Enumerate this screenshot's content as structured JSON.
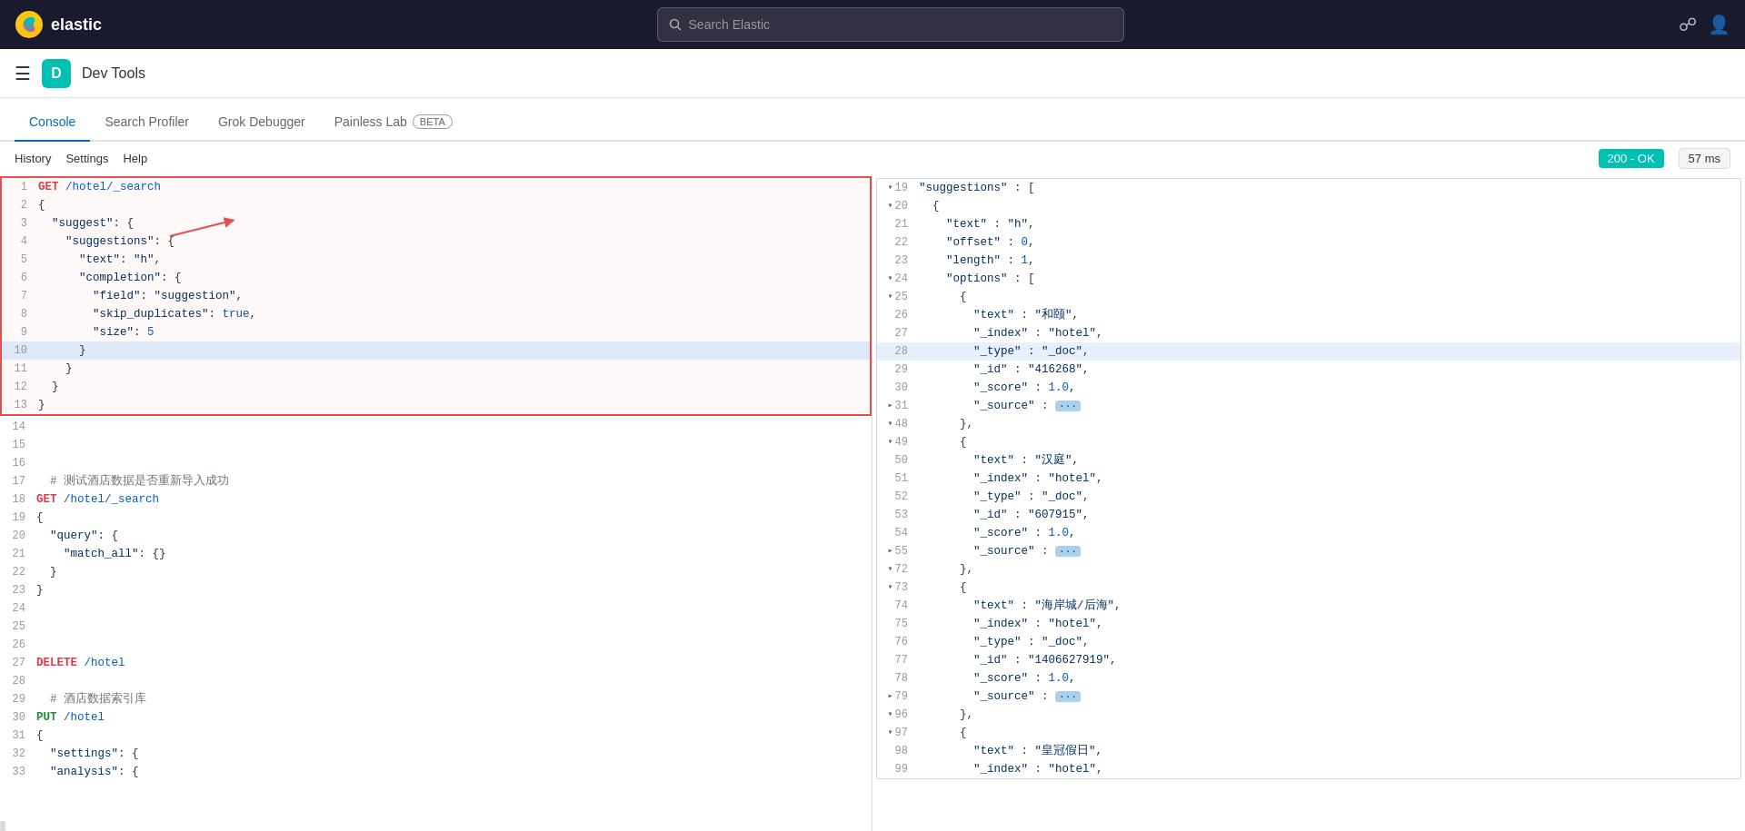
{
  "topbar": {
    "logo_text": "elastic",
    "search_placeholder": "Search Elastic",
    "app_title": "Dev Tools",
    "app_badge": "D"
  },
  "tabs": [
    {
      "id": "console",
      "label": "Console",
      "active": true,
      "beta": false
    },
    {
      "id": "search-profiler",
      "label": "Search Profiler",
      "active": false,
      "beta": false
    },
    {
      "id": "grok-debugger",
      "label": "Grok Debugger",
      "active": false,
      "beta": false
    },
    {
      "id": "painless-lab",
      "label": "Painless Lab",
      "active": false,
      "beta": true
    }
  ],
  "toolbar": {
    "history_label": "History",
    "settings_label": "Settings",
    "help_label": "Help",
    "status": "200 - OK",
    "ms": "57 ms"
  },
  "editor": {
    "lines": [
      {
        "num": 1,
        "content": "GET /hotel/_search",
        "type": "request",
        "selected": true
      },
      {
        "num": 2,
        "content": "{",
        "selected": true
      },
      {
        "num": 3,
        "content": "  \"suggest\": {",
        "selected": true
      },
      {
        "num": 4,
        "content": "    \"suggestions\": {",
        "selected": true
      },
      {
        "num": 5,
        "content": "      \"text\": \"h\",",
        "selected": true
      },
      {
        "num": 6,
        "content": "      \"completion\": {",
        "selected": true
      },
      {
        "num": 7,
        "content": "        \"field\": \"suggestion\",",
        "selected": true
      },
      {
        "num": 8,
        "content": "        \"skip_duplicates\": true,",
        "selected": true
      },
      {
        "num": 9,
        "content": "        \"size\": 5",
        "selected": true
      },
      {
        "num": 10,
        "content": "      }",
        "selected": true
      },
      {
        "num": 11,
        "content": "    }",
        "selected": true
      },
      {
        "num": 12,
        "content": "  }",
        "selected": true
      },
      {
        "num": 13,
        "content": "}",
        "selected": true
      },
      {
        "num": 14,
        "content": "",
        "selected": false
      },
      {
        "num": 15,
        "content": "",
        "selected": false
      },
      {
        "num": 16,
        "content": "",
        "selected": false
      },
      {
        "num": 17,
        "content": "  # 测试酒店数据是否重新导入成功",
        "selected": false,
        "comment": true
      },
      {
        "num": 18,
        "content": "GET /hotel/_search",
        "selected": false
      },
      {
        "num": 19,
        "content": "{",
        "selected": false
      },
      {
        "num": 20,
        "content": "  \"query\": {",
        "selected": false
      },
      {
        "num": 21,
        "content": "    \"match_all\": {}",
        "selected": false
      },
      {
        "num": 22,
        "content": "  }",
        "selected": false
      },
      {
        "num": 23,
        "content": "}",
        "selected": false
      },
      {
        "num": 24,
        "content": "",
        "selected": false
      },
      {
        "num": 25,
        "content": "",
        "selected": false
      },
      {
        "num": 26,
        "content": "",
        "selected": false
      },
      {
        "num": 27,
        "content": "DELETE /hotel",
        "selected": false
      },
      {
        "num": 28,
        "content": "",
        "selected": false
      },
      {
        "num": 29,
        "content": "  # 酒店数据索引库",
        "selected": false,
        "comment": true
      },
      {
        "num": 30,
        "content": "PUT /hotel",
        "selected": false
      },
      {
        "num": 31,
        "content": "{",
        "selected": false
      },
      {
        "num": 32,
        "content": "  \"settings\": {",
        "selected": false
      },
      {
        "num": 33,
        "content": "  \"analysis\": {",
        "selected": false
      }
    ]
  },
  "results": {
    "lines": [
      {
        "num": 19,
        "arrow": true,
        "content": "\"suggestions\" : ["
      },
      {
        "num": 20,
        "arrow": true,
        "content": "  {"
      },
      {
        "num": 21,
        "content": "    \"text\" : \"h\","
      },
      {
        "num": 22,
        "content": "    \"offset\" : 0,"
      },
      {
        "num": 23,
        "content": "    \"length\" : 1,"
      },
      {
        "num": 24,
        "arrow": true,
        "content": "    \"options\" : ["
      },
      {
        "num": 25,
        "arrow": true,
        "content": "      {"
      },
      {
        "num": 26,
        "content": "        \"text\" : \"和颐\","
      },
      {
        "num": 27,
        "content": "        \"_index\" : \"hotel\","
      },
      {
        "num": 28,
        "content": "        \"_type\" : \"_doc\",",
        "highlight": true
      },
      {
        "num": 29,
        "content": "        \"_id\" : \"416268\","
      },
      {
        "num": 30,
        "content": "        \"_score\" : 1.0,"
      },
      {
        "num": 31,
        "content": "        \"_source\" : {…}"
      },
      {
        "num": 48,
        "arrow": true,
        "content": "      },"
      },
      {
        "num": 49,
        "arrow": true,
        "content": "      {"
      },
      {
        "num": 50,
        "content": "        \"text\" : \"汉庭\","
      },
      {
        "num": 51,
        "content": "        \"_index\" : \"hotel\","
      },
      {
        "num": 52,
        "content": "        \"_type\" : \"_doc\","
      },
      {
        "num": 53,
        "content": "        \"_id\" : \"607915\","
      },
      {
        "num": 54,
        "content": "        \"_score\" : 1.0,"
      },
      {
        "num": 55,
        "arrow": true,
        "content": "        \"_source\" : {…}"
      },
      {
        "num": 72,
        "arrow": true,
        "content": "      },"
      },
      {
        "num": 73,
        "arrow": true,
        "content": "      {"
      },
      {
        "num": 74,
        "content": "        \"text\" : \"海岸城/后海\","
      },
      {
        "num": 75,
        "content": "        \"_index\" : \"hotel\","
      },
      {
        "num": 76,
        "content": "        \"_type\" : \"_doc\","
      },
      {
        "num": 77,
        "content": "        \"_id\" : \"1406627919\","
      },
      {
        "num": 78,
        "content": "        \"_score\" : 1.0,"
      },
      {
        "num": 79,
        "arrow": true,
        "content": "        \"_source\" : {…}"
      },
      {
        "num": 96,
        "arrow": true,
        "content": "      },"
      },
      {
        "num": 97,
        "arrow": true,
        "content": "      {"
      },
      {
        "num": 98,
        "content": "        \"text\" : \"皇冠假日\","
      },
      {
        "num": 99,
        "content": "        \"_index\" : \"hotel\","
      }
    ]
  }
}
